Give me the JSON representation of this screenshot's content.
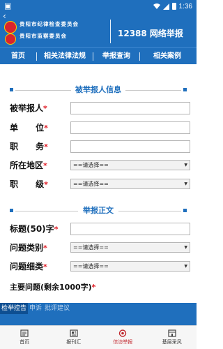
{
  "status_bar": {
    "time": "1:36",
    "left_icon": "image-icon"
  },
  "header": {
    "org_line1": "贵阳市纪律检查委员会",
    "org_line2": "贵阳市监察委员会",
    "title": "12388 网络举报"
  },
  "nav": {
    "items": [
      "首页",
      "相关法律法规",
      "举报查询",
      "相关案例"
    ]
  },
  "section1": {
    "title": "被举报人信息",
    "fields": [
      {
        "label": "被举报人",
        "required": "*"
      },
      {
        "label": "单      位",
        "required": "*"
      },
      {
        "label": "职      务",
        "required": "*"
      },
      {
        "label": "所在地区",
        "required": "*",
        "select": "==请选择=="
      },
      {
        "label": "职      级",
        "required": "*",
        "select": "==请选择=="
      }
    ]
  },
  "section2": {
    "title": "举报正文",
    "fields": [
      {
        "label": "标题(50)字",
        "required": "*"
      },
      {
        "label": "问题类别",
        "required": "*",
        "select": "==请选择=="
      },
      {
        "label": "问题细类",
        "required": "*",
        "select": "==请选择=="
      }
    ],
    "main_issue_label": "主要问题(剩余1000字)",
    "main_issue_required": "*"
  },
  "text_tabs": [
    "检举控告",
    "申诉",
    "批评建议"
  ],
  "bottom_nav": {
    "items": [
      {
        "label": "首页",
        "icon": "home-icon"
      },
      {
        "label": "报刊汇",
        "icon": "newspaper-icon"
      },
      {
        "label": "信访举报",
        "icon": "report-icon",
        "active": true
      },
      {
        "label": "基层采风",
        "icon": "grassroots-icon"
      }
    ]
  },
  "colors": {
    "brand_blue": "#1f6fbd",
    "required_red": "#e01b24",
    "active_tab_red": "#c0272d"
  }
}
